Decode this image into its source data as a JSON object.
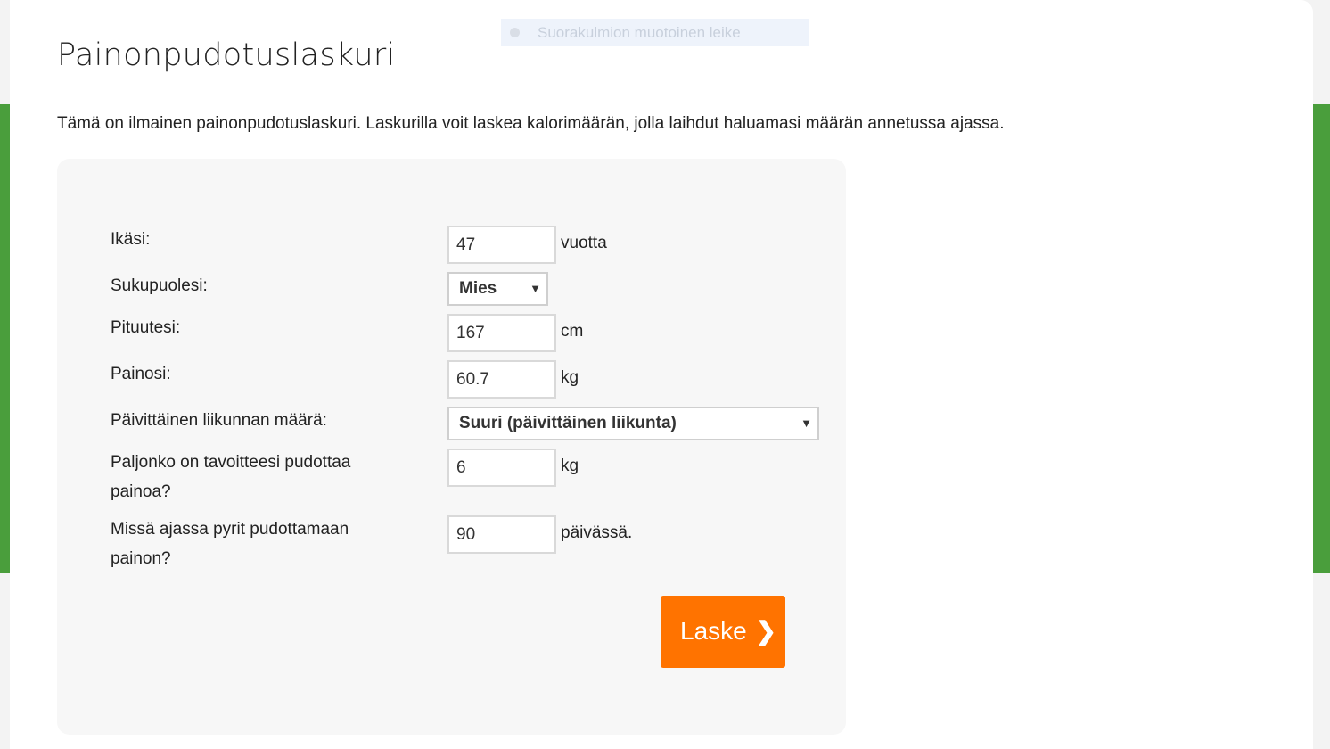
{
  "ghost_chip": {
    "label": "Suorakulmion muotoinen leike"
  },
  "title": "Painonpudotuslaskuri",
  "intro": "Tämä on ilmainen painonpudotuslaskuri. Laskurilla voit laskea kalorimäärän, jolla laihdut haluamasi määrän annetussa ajassa.",
  "form": {
    "age": {
      "label": "Ikäsi:",
      "value": "47",
      "unit": "vuotta"
    },
    "gender": {
      "label": "Sukupuolesi:",
      "selected": "Mies"
    },
    "height": {
      "label": "Pituutesi:",
      "value": "167",
      "unit": "cm"
    },
    "weight": {
      "label": "Painosi:",
      "value": "60.7",
      "unit": "kg"
    },
    "activity": {
      "label": "Päivittäinen liikunnan määrä:",
      "selected": "Suuri (päivittäinen liikunta)"
    },
    "goal": {
      "label_line1": "Paljonko on tavoitteesi pudottaa",
      "label_line2": "painoa?",
      "value": "6",
      "unit": "kg"
    },
    "duration": {
      "label_line1": "Missä ajassa pyrit pudottamaan",
      "label_line2": "painon?",
      "value": "90",
      "unit": "päivässä."
    },
    "submit_label": "Laske",
    "submit_icon": "chevron-right-icon"
  },
  "colors": {
    "accent_green": "#4a9e3c",
    "button_orange": "#ff7300"
  }
}
